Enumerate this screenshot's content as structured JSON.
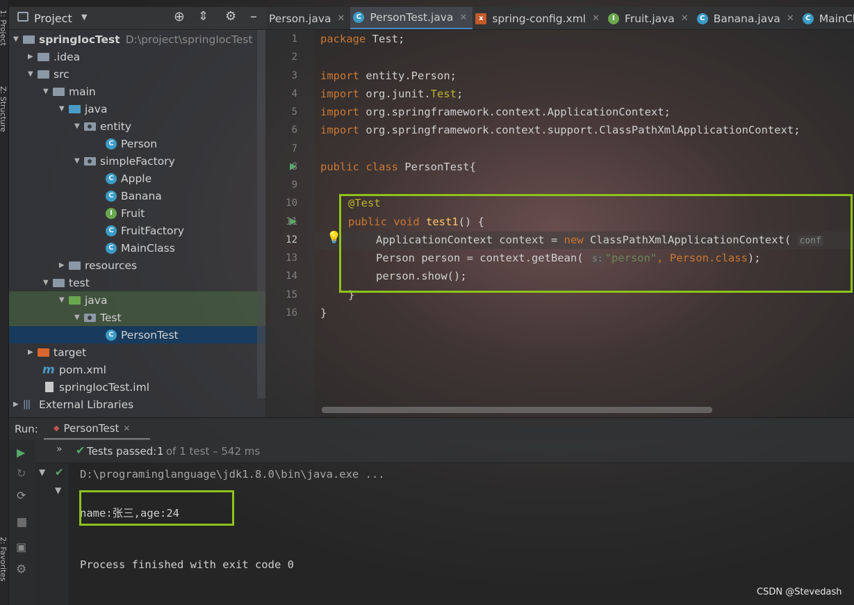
{
  "colors": {
    "highlight_box": "#8ec31b",
    "keyword": "#cc7832",
    "annotation": "#bbb529",
    "string": "#6a8759",
    "function": "#ffc66d",
    "selection": "#143c64"
  },
  "side_strip": {
    "project_label": "1: Project",
    "structure_label": "Z: Structure",
    "favorites_label": "2: Favorites"
  },
  "project_panel": {
    "title": "Project",
    "tree": [
      {
        "label": "springIocTest",
        "path": "D:\\project\\springIocTest"
      },
      {
        "label": ".idea"
      },
      {
        "label": "src"
      },
      {
        "label": "main"
      },
      {
        "label": "java"
      },
      {
        "label": "entity"
      },
      {
        "label": "Person"
      },
      {
        "label": "simpleFactory"
      },
      {
        "label": "Apple"
      },
      {
        "label": "Banana"
      },
      {
        "label": "Fruit"
      },
      {
        "label": "FruitFactory"
      },
      {
        "label": "MainClass"
      },
      {
        "label": "resources"
      },
      {
        "label": "test"
      },
      {
        "label": "java"
      },
      {
        "label": "Test"
      },
      {
        "label": "PersonTest"
      },
      {
        "label": "target"
      },
      {
        "label": "pom.xml"
      },
      {
        "label": "springIocTest.iml"
      },
      {
        "label": "External Libraries"
      }
    ]
  },
  "tabs": [
    "Person.java",
    "PersonTest.java",
    "spring-config.xml",
    "Fruit.java",
    "Banana.java",
    "MainCla"
  ],
  "editor": {
    "line_numbers": [
      "1",
      "2",
      "3",
      "4",
      "5",
      "6",
      "7",
      "8",
      "9",
      "10",
      "11",
      "12",
      "13",
      "14",
      "15",
      "16"
    ],
    "code": {
      "l1a": "package",
      "l1b": " Test;",
      "l3a": "import",
      "l3b": " entity.Person;",
      "l4a": "import",
      "l4b": " org.junit.",
      "l4c": "Test",
      "l4d": ";",
      "l5a": "import",
      "l5b": " org.springframework.context.ApplicationContext;",
      "l6a": "import",
      "l6b": " org.springframework.context.support.ClassPathXmlApplicationContext;",
      "l8a": "public class",
      "l8b": " PersonTest{",
      "l10": "@Test",
      "l11a": "public void ",
      "l11b": "test1",
      "l11c": "() {",
      "l12a": "ApplicationContext context = ",
      "l12b": "new",
      "l12c": " ClassPathXmlApplicationContext( ",
      "l12d": "conf",
      "l13a": "Person person = context.getBean( ",
      "l13h": "s:",
      "l13b": "\"person\"",
      "l13c": ", Person.",
      "l13d": "class",
      "l13e": ");",
      "l14": "person.show();",
      "l15": "}",
      "l16": "}"
    }
  },
  "run_panel": {
    "label": "Run:",
    "tab": "PersonTest",
    "status_prefix": "Tests passed:",
    "status_count": "1",
    "status_suffix": "of 1 test – 542 ms",
    "console": [
      "D:\\programinglanguage\\jdk1.8.0\\bin\\java.exe ...",
      "name:张三,age:24",
      "Process finished with exit code 0"
    ]
  },
  "watermark": "CSDN @Stevedash"
}
